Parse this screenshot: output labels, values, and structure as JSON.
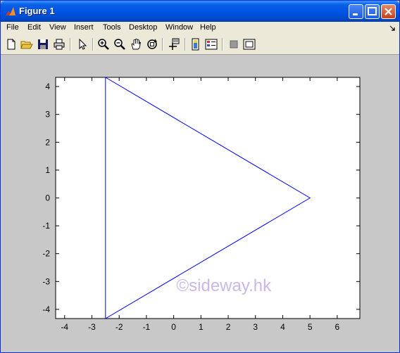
{
  "window": {
    "title": "Figure 1"
  },
  "menu": {
    "items": [
      "File",
      "Edit",
      "View",
      "Insert",
      "Tools",
      "Desktop",
      "Window",
      "Help"
    ]
  },
  "toolbar": {
    "tools": [
      "new-figure",
      "open-file",
      "save-figure",
      "print-figure",
      "edit-plot",
      "zoom-in",
      "zoom-out",
      "pan",
      "rotate-3d",
      "data-cursor",
      "insert-colorbar",
      "insert-legend",
      "hide-plot-tools",
      "show-plot-tools"
    ]
  },
  "watermark": "©sideway.hk",
  "colors": {
    "line": "#0000ff",
    "titlebar": "#0054e3",
    "canvas": "#c8c8c8"
  },
  "chart_data": {
    "type": "line",
    "series": [
      {
        "x": [
          -2.5,
          5,
          -2.5,
          -2.5
        ],
        "y": [
          4.33,
          0,
          -4.33,
          4.33
        ]
      }
    ],
    "xlim": [
      -4.33,
      6.83
    ],
    "ylim": [
      -4.33,
      4.33
    ],
    "xticks": [
      -4,
      -3,
      -2,
      -1,
      0,
      1,
      2,
      3,
      4,
      5,
      6
    ],
    "yticks": [
      -4,
      -3,
      -2,
      -1,
      0,
      1,
      2,
      3,
      4
    ],
    "grid": false
  }
}
